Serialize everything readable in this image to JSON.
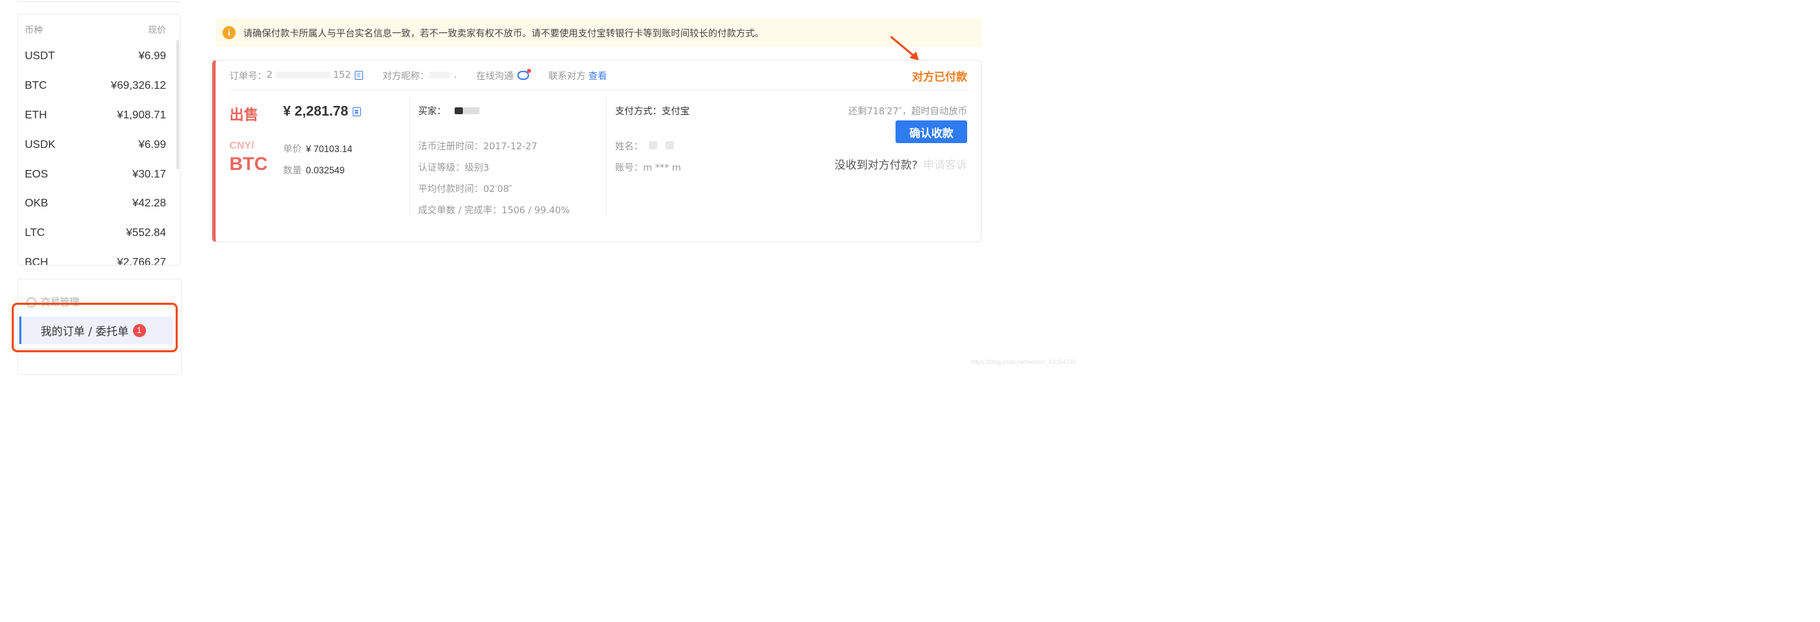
{
  "price_list": {
    "header_currency": "币种",
    "header_price": "现价",
    "items": [
      {
        "symbol": "USDT",
        "price": "¥6.99"
      },
      {
        "symbol": "BTC",
        "price": "¥69,326.12"
      },
      {
        "symbol": "ETH",
        "price": "¥1,908.71"
      },
      {
        "symbol": "USDK",
        "price": "¥6.99"
      },
      {
        "symbol": "EOS",
        "price": "¥30.17"
      },
      {
        "symbol": "OKB",
        "price": "¥42.28"
      },
      {
        "symbol": "LTC",
        "price": "¥552.84"
      },
      {
        "symbol": "BCH",
        "price": "¥2,766.27"
      }
    ]
  },
  "nav": {
    "section_title": "交易管理",
    "active_item": "我的订单 / 委托单",
    "badge_count": "1"
  },
  "notice": {
    "icon": "info-icon",
    "text": "请确保付款卡所属人与平台实名信息一致，若不一致卖家有权不放币。请不要使用支付宝转银行卡等到账时间较长的付款方式。"
  },
  "order": {
    "order_no_label": "订单号：",
    "order_no_start": "2",
    "order_no_end": "152",
    "nickname_label": "对方昵称：",
    "nickname_tail": ".",
    "chat_label": "在线沟通",
    "contact_label": "联系对方",
    "contact_link": "查看",
    "status": "对方已付款",
    "side": "出售",
    "total": "¥ 2,281.78",
    "quote": "CNY/",
    "coin": "BTC",
    "unit_price_label": "单价",
    "unit_price": "¥ 70103.14",
    "quantity_label": "数量",
    "quantity": "0.032549",
    "buyer_label": "买家：",
    "fiat_register_label": "法币注册时间：",
    "fiat_register_value": "2017-12-27",
    "cert_level_label": "认证等级：",
    "cert_level_value": "级别3",
    "avg_pay_time_label": "平均付款时间：",
    "avg_pay_time_value": "02′08″",
    "deals_label": "成交单数 / 完成率：",
    "deals_value": "1506 / 99.40%",
    "pay_method_label": "支付方式：",
    "pay_method_value": "支付宝",
    "name_label": "姓名：",
    "account_label": "账号：",
    "account_value": "m *** m",
    "remaining": "还剩718′27″，超时自动放币",
    "confirm_button": "确认收款",
    "not_received": "没收到对方付款?",
    "appeal": "申请客诉"
  },
  "watermark": "https://blog.csdn.net/weixin_43054766",
  "colors": {
    "accent_blue": "#2f7bf2",
    "sell_red": "#e8675f",
    "status_orange": "#f07a1a",
    "highlight_orange": "#ef4d15"
  }
}
